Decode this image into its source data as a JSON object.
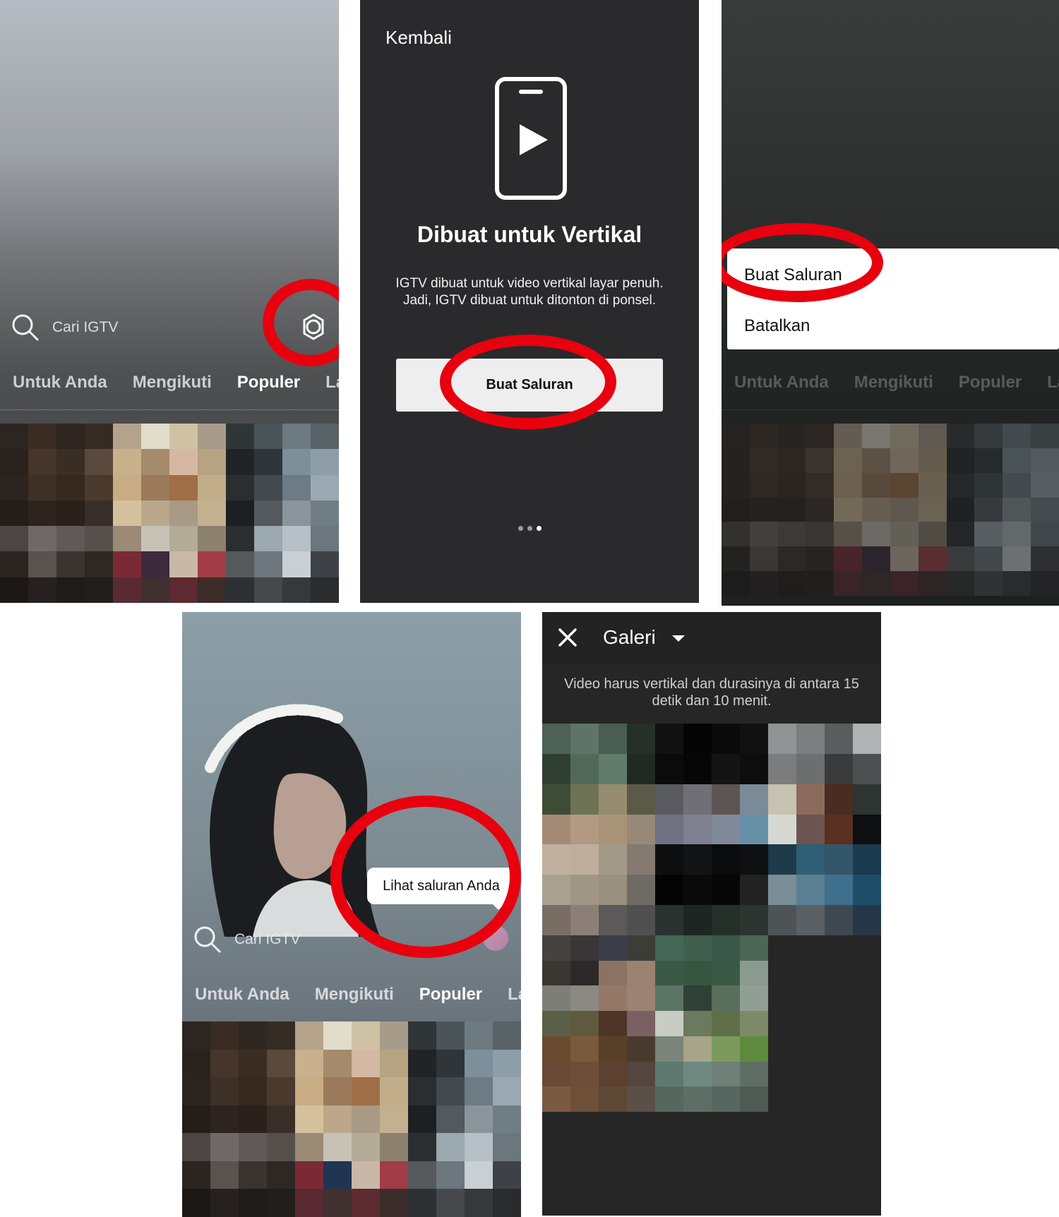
{
  "panel1": {
    "search_placeholder": "Cari IGTV",
    "tabs": [
      "Untuk Anda",
      "Mengikuti",
      "Populer",
      "Lan"
    ],
    "active_tab": "Populer",
    "settings_icon": "gear-icon"
  },
  "panel2": {
    "back_label": "Kembali",
    "icon": "phone-play-icon",
    "title": "Dibuat untuk Vertikal",
    "body": "IGTV dibuat untuk video vertikal layar penuh. Jadi, IGTV dibuat untuk ditonton di ponsel.",
    "button_label": "Buat Saluran",
    "page_dots": 3,
    "active_dot": 3
  },
  "panel3": {
    "menu_items": [
      "Buat Saluran",
      "Batalkan"
    ],
    "tabs": [
      "Untuk Anda",
      "Mengikuti",
      "Populer",
      "Lan"
    ]
  },
  "panel4": {
    "search_placeholder": "Cari IGTV",
    "tooltip": "Lihat saluran Anda",
    "tabs": [
      "Untuk Anda",
      "Mengikuti",
      "Populer",
      "Lan"
    ],
    "active_tab": "Populer"
  },
  "panel5": {
    "close_icon": "close-icon",
    "title": "Galeri",
    "note": "Video harus vertikal dan durasinya di antara 15 detik dan 10 menit."
  },
  "colors": {
    "annotation_red": "#e8000e",
    "dark_bg": "#2a2a2c",
    "button_bg": "#eeeeee"
  }
}
